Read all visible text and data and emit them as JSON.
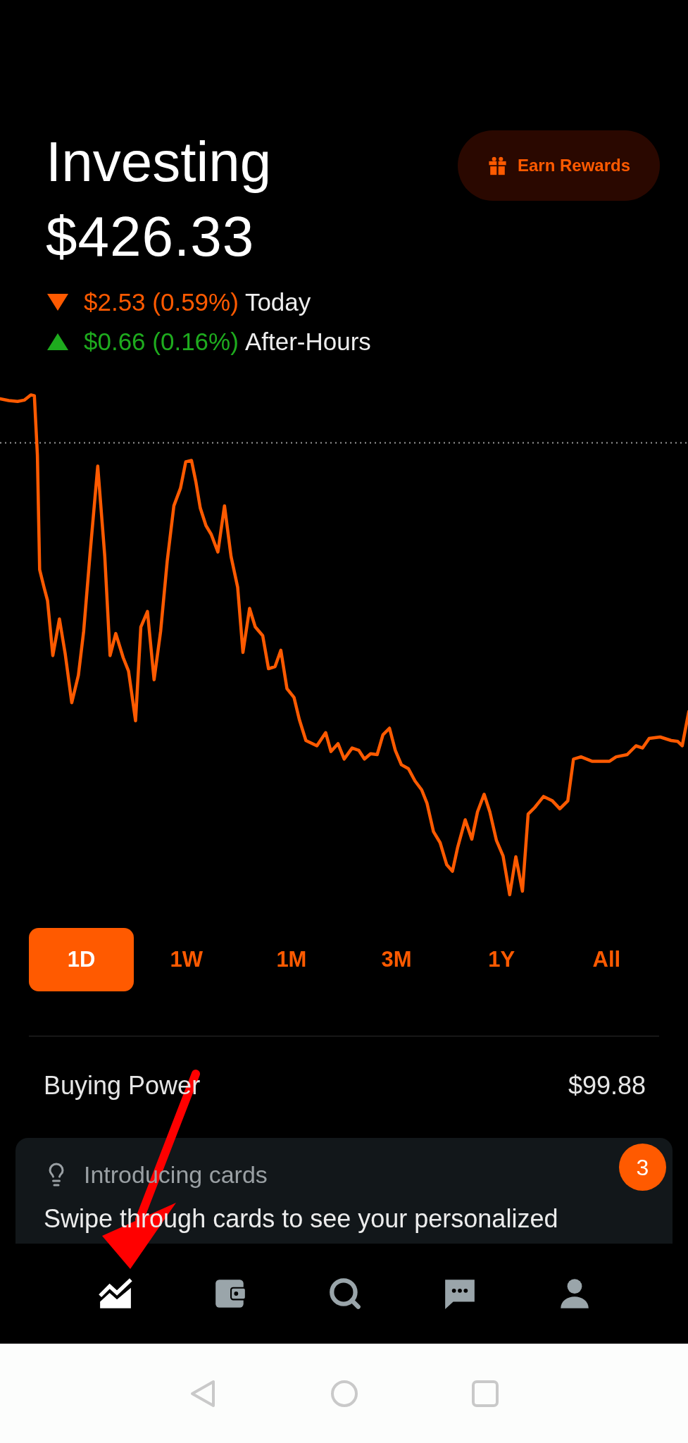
{
  "header": {
    "title": "Investing",
    "balance": "$426.33",
    "rewards_button": {
      "label": "Earn Rewards"
    }
  },
  "changes": [
    {
      "kind": "loss",
      "amount": "$2.53 (0.59%)",
      "period": "Today"
    },
    {
      "kind": "gain",
      "amount": "$0.66 (0.16%)",
      "period": "After-Hours"
    }
  ],
  "ranges": [
    {
      "label": "1D",
      "selected": true
    },
    {
      "label": "1W",
      "selected": false
    },
    {
      "label": "1M",
      "selected": false
    },
    {
      "label": "3M",
      "selected": false
    },
    {
      "label": "1Y",
      "selected": false
    },
    {
      "label": "All",
      "selected": false
    }
  ],
  "buying_power": {
    "label": "Buying Power",
    "value": "$99.88"
  },
  "card": {
    "title": "Introducing cards",
    "badge": "3",
    "text": "Swipe through cards to see your personalized"
  },
  "bottom_nav": [
    {
      "kind": "chart",
      "selected": true
    },
    {
      "kind": "wallet",
      "selected": false
    },
    {
      "kind": "search",
      "selected": false
    },
    {
      "kind": "messages",
      "selected": false
    },
    {
      "kind": "profile",
      "selected": false
    }
  ]
}
